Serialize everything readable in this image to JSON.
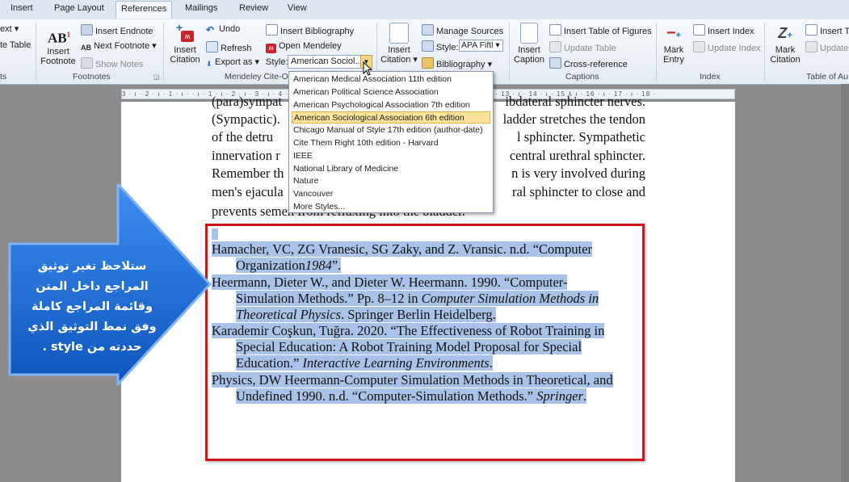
{
  "tabs": [
    "Insert",
    "Page Layout",
    "References",
    "Mailings",
    "Review",
    "View"
  ],
  "active_tab": "References",
  "ribbon": {
    "toc_partial": [
      "ext ▾",
      "te Table",
      "ts"
    ],
    "footnotes": {
      "insert_footnote": "Insert Footnote",
      "insert_endnote": "Insert Endnote",
      "next_footnote": "Next Footnote ▾",
      "show_notes": "Show Notes",
      "label": "Footnotes"
    },
    "mendeley": {
      "insert_citation": "Insert Citation",
      "undo": "Undo",
      "refresh": "Refresh",
      "export_as": "Export as ▾",
      "insert_bibliography": "Insert Bibliography",
      "open_mendeley": "Open Mendeley",
      "style_label": "Style:",
      "style_value": "American Sociol...",
      "label": "Mendeley Cite-O"
    },
    "citations": {
      "insert_citation": "Insert Citation ▾",
      "manage_sources": "Manage Sources",
      "style_label": "Style:",
      "style_value": "APA Fiftl ▾",
      "bibliography": "Bibliography ▾"
    },
    "captions": {
      "insert_caption": "Insert Caption",
      "insert_table_of_figures": "Insert Table of Figures",
      "update_table": "Update Table",
      "cross_reference": "Cross-reference",
      "label": "Captions"
    },
    "index": {
      "mark_entry": "Mark Entry",
      "insert_index": "Insert Index",
      "update_index": "Update Index",
      "label": "Index"
    },
    "toa": {
      "mark_citation": "Mark Citation",
      "insert_t": "Insert T",
      "update": "Update",
      "label": "Table of Au"
    }
  },
  "ruler_text": "3 · ı · 2 · ı · 1 · ı ·     · ı · 1 · ı · 2 · ı · 3 · ı · 4 · ı · 5 · ı · 6 · ı · 7 · ı · 8 · ı · 9 · ı · 10 · ı · 11 · ı · 12 · ı · 13 · ı · 14 · ı · 15 ⅄ ı · 16 · ı · 17 · ı · 18 ·",
  "style_dropdown": {
    "items": [
      "American Medical Association 11th edition",
      "American Political Science Association",
      "American Psychological Association 7th edition",
      "American Sociological Association 6th edition",
      "Chicago Manual of Style 17th edition (author-date)",
      "Cite Them Right 10th edition - Harvard",
      "IEEE",
      "National Library of Medicine",
      "Nature",
      "Vancouver",
      "More Styles..."
    ],
    "selected_index": 3
  },
  "body_text": {
    "lines": [
      {
        "left": "(para)sympat",
        "right": "ibdateral sphincter nerves."
      },
      {
        "left": "(Sympactic).",
        "right": "ladder stretches the tendon"
      },
      {
        "left": "of the detru",
        "right": "l sphincter. Sympathetic"
      },
      {
        "left": "innervation r",
        "right": "central urethral sphincter."
      },
      {
        "left": "Remember th",
        "right": "n is very involved during"
      },
      {
        "left": "men's ejacula",
        "right": "ral sphincter to close and"
      },
      {
        "left": "prevents semen from refluxing into the bladder.",
        "right": ""
      }
    ]
  },
  "bibliography": [
    {
      "l1": "Hamacher, VC, ZG Vranesic, SG Zaky, and Z. Vransic. n.d. “Computer",
      "l2a": "Organization",
      "l2b": "1984",
      "l2c": "”."
    },
    {
      "l1": "Heermann, Dieter W., and Dieter W. Heermann. 1990. “Computer-",
      "l2a": "Simulation Methods.” Pp. 8–12 in ",
      "l2b": "Computer Simulation Methods in",
      "l3a": "Theoretical Physics",
      "l3b": ". Springer Berlin Heidelberg."
    },
    {
      "l1": "Karademir Coşkun, Tuğra. 2020. “The Effectiveness of Robot Training in",
      "l2a": "Special Education: A Robot Training Model Proposal for Special",
      "l3a": "Education.” ",
      "l3b": "Interactive Learning Environments",
      "l3c": "."
    },
    {
      "l1": "Physics, DW Heermann-Computer Simulation Methods in Theoretical, and",
      "l2a": "Undefined 1990. n.d. “Computer-Simulation Methods.” ",
      "l2b": "Springer",
      "l2c": "."
    }
  ],
  "callout": {
    "lines": [
      "ستلاحظ تغير توثيق",
      "المراجع داخل المتن",
      "وقائمة المراجع كاملة",
      "وفق نمط التوثيق الذي",
      "حددته من style ."
    ],
    "color": "#1d6fd6"
  }
}
